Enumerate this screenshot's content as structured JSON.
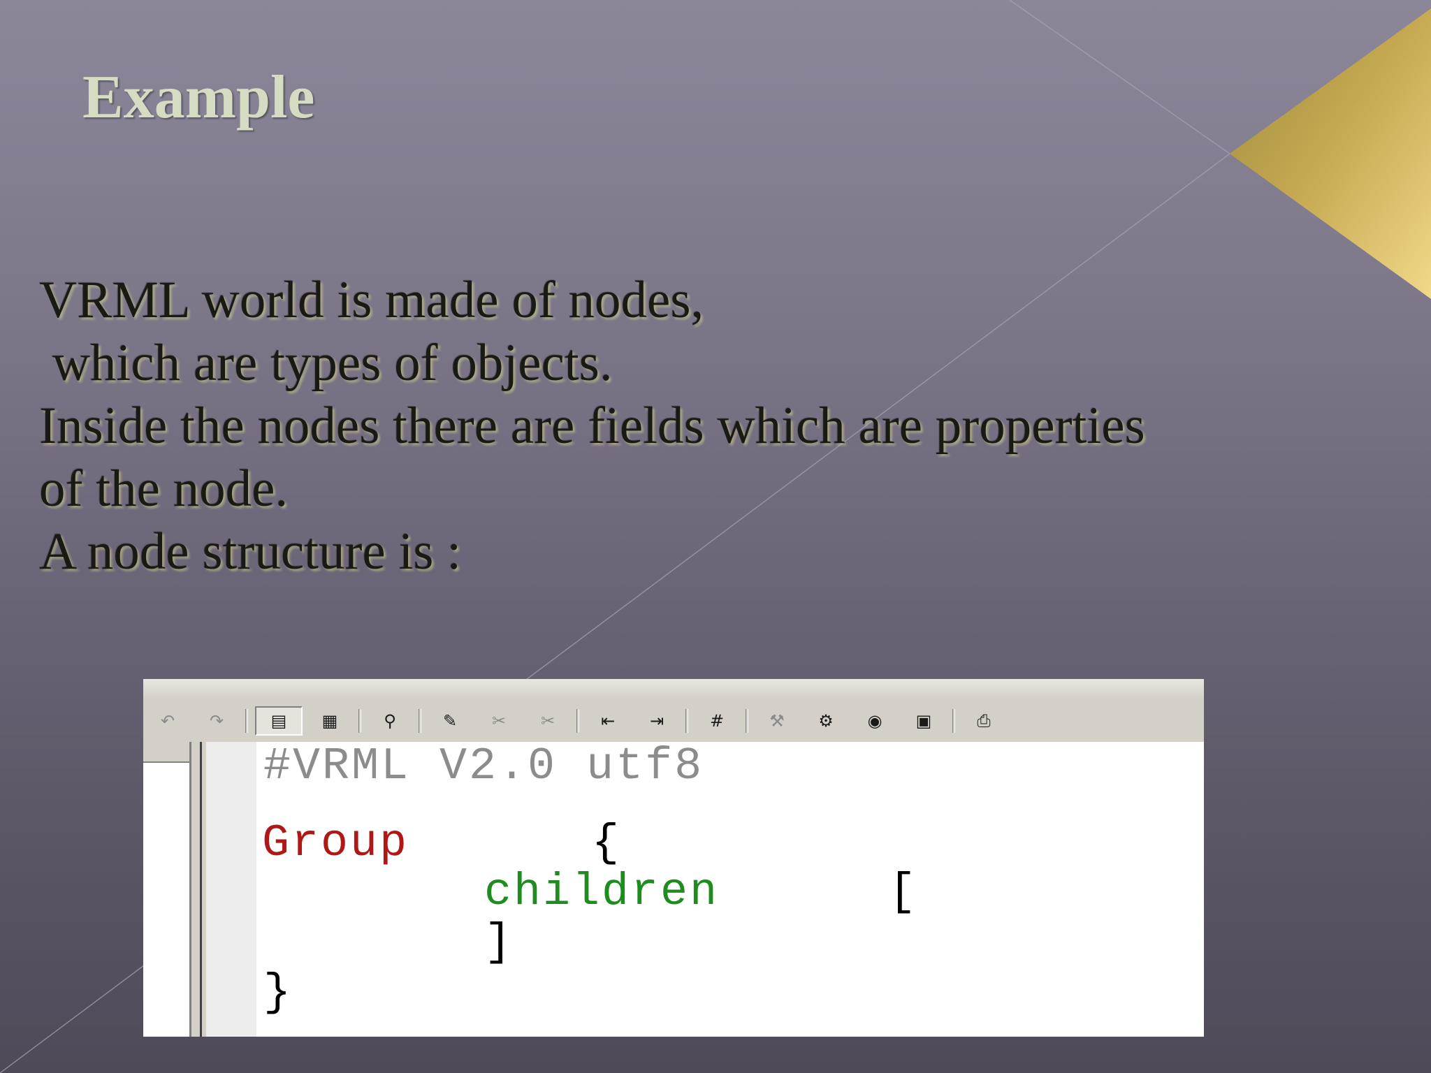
{
  "slide": {
    "title": "Example",
    "body_lines": [
      "VRML world is made of nodes,",
      " which are types of objects.",
      "Inside the nodes there are fields which are properties",
      "of the node.",
      "A node structure is :"
    ]
  },
  "editor": {
    "toolbar_icons": [
      "undo-icon",
      "redo-icon",
      "view-icon",
      "view-tree-icon",
      "find-icon",
      "pen-icon",
      "cut-icon",
      "paste-icon",
      "outdent-icon",
      "indent-icon",
      "comment-icon",
      "build-icon",
      "tools-icon",
      "world-icon",
      "preview-icon",
      "print-icon"
    ],
    "code": {
      "header": "#VRML V2.0 utf8",
      "group_keyword": "Group",
      "group_open": "{",
      "children_keyword": "children",
      "bracket_open": "[",
      "bracket_close": "]",
      "group_close": "}"
    }
  },
  "colors": {
    "title": "#d6dcc2",
    "body_text": "#1a1a14",
    "accent_gold": "#c9a94a",
    "code_comment": "#8c8c8c",
    "code_keyword": "#b01818",
    "code_field": "#1f8c1f"
  }
}
